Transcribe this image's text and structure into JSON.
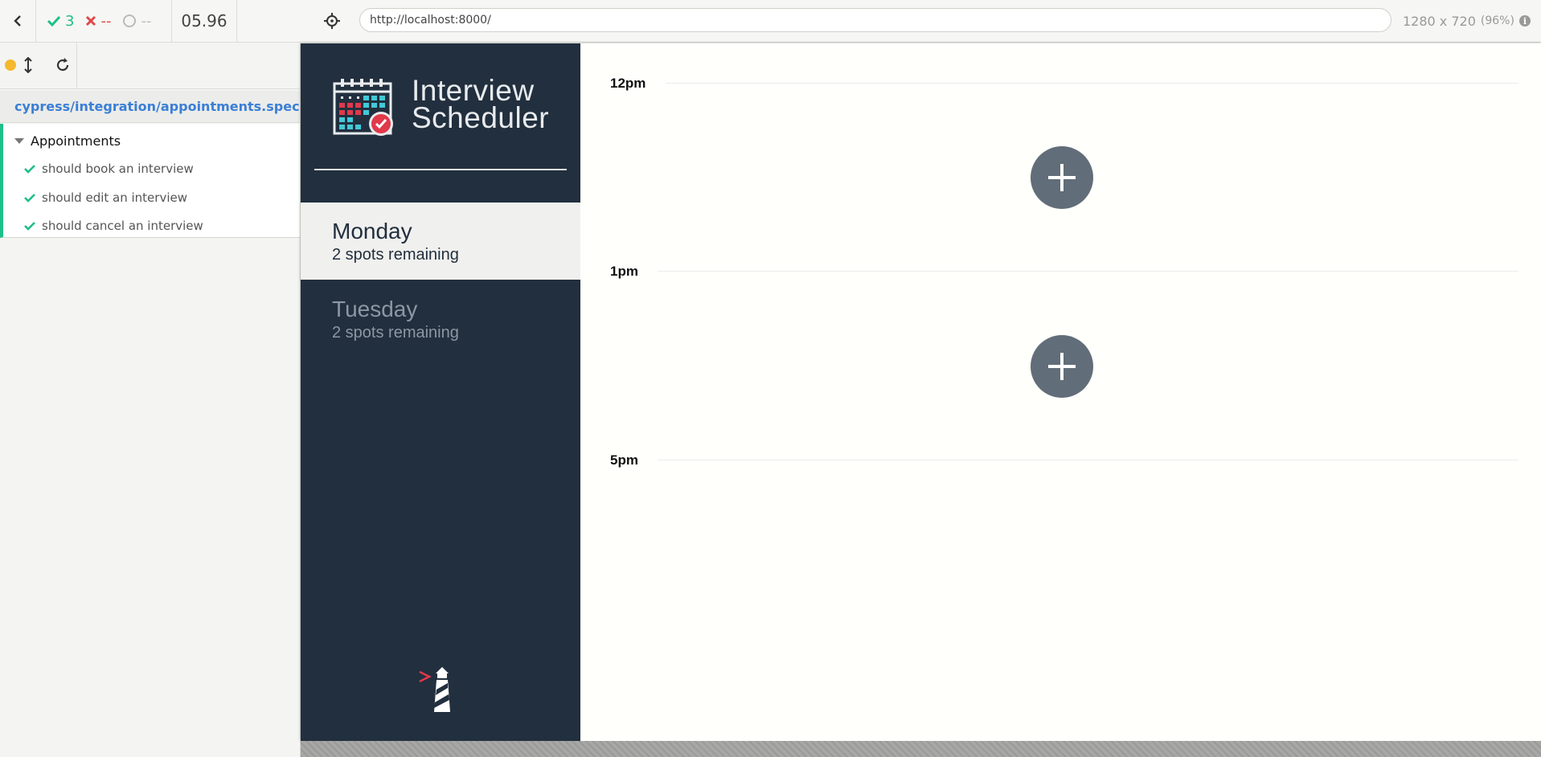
{
  "reporter": {
    "stats": {
      "passed": "3",
      "failed": "--",
      "pending": "--",
      "duration": "05.96"
    },
    "spec_path": "cypress/integration/appointments.spec.js",
    "suite": {
      "title": "Appointments",
      "tests": [
        {
          "title": "should book an interview",
          "state": "passed"
        },
        {
          "title": "should edit an interview",
          "state": "passed"
        },
        {
          "title": "should cancel an interview",
          "state": "passed"
        }
      ]
    }
  },
  "runner": {
    "url": "http://localhost:8000/",
    "viewport": "1280 x 720",
    "scale": "(96%)"
  },
  "app": {
    "brand": {
      "line1": "Interview",
      "line2": "Scheduler"
    },
    "days": [
      {
        "name": "Monday",
        "spots": "2 spots remaining",
        "selected": true
      },
      {
        "name": "Tuesday",
        "spots": "2 spots remaining",
        "selected": false
      }
    ],
    "schedule": [
      {
        "time": "12pm",
        "empty": true
      },
      {
        "time": "1pm",
        "empty": true
      },
      {
        "time": "5pm",
        "last": true
      }
    ]
  },
  "colors": {
    "sidebar_bg": "#222f3e",
    "pass_green": "#1ebf88",
    "fail_red": "#e04848",
    "link_blue": "#3a7fd6",
    "add_button": "#616d78"
  }
}
